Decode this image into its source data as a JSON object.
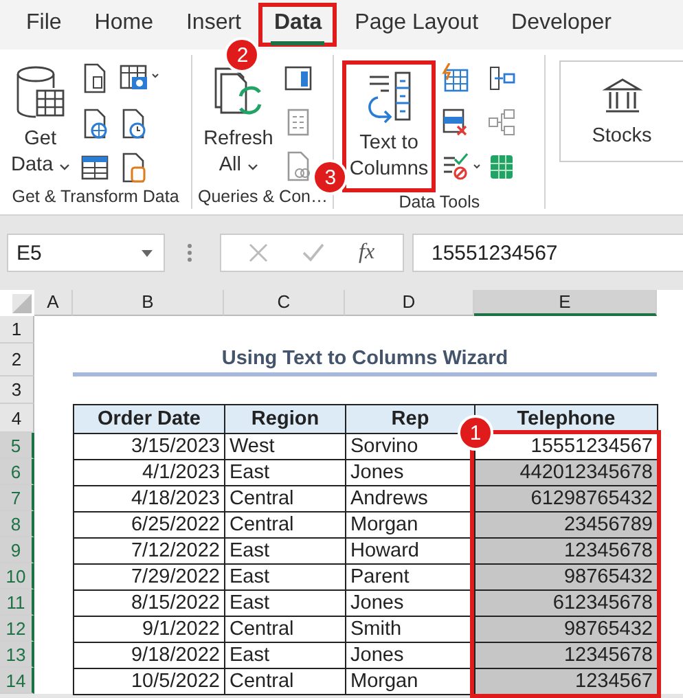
{
  "tabs": [
    {
      "label": "File",
      "selected": false
    },
    {
      "label": "Home",
      "selected": false
    },
    {
      "label": "Insert",
      "selected": false
    },
    {
      "label": "Data",
      "selected": true,
      "callout": "2"
    },
    {
      "label": "Page Layout",
      "selected": false
    },
    {
      "label": "Developer",
      "selected": false
    }
  ],
  "ribbon": {
    "get_data": {
      "lines": [
        "Get",
        "Data"
      ]
    },
    "refresh_all": {
      "lines": [
        "Refresh",
        "All"
      ]
    },
    "text_to_columns": {
      "lines": [
        "Text to",
        "Columns"
      ],
      "highlighted": true,
      "callout": "3"
    },
    "stocks": {
      "label": "Stocks"
    },
    "group_labels": [
      "Get & Transform Data",
      "Queries & Con…",
      "Data Tools"
    ]
  },
  "formula_bar": {
    "name_box": "E5",
    "function_label": "fx",
    "formula": "15551234567"
  },
  "columns": [
    {
      "letter": "A",
      "selected": false
    },
    {
      "letter": "B",
      "selected": false
    },
    {
      "letter": "C",
      "selected": false
    },
    {
      "letter": "D",
      "selected": false
    },
    {
      "letter": "E",
      "selected": true
    }
  ],
  "rows": [
    {
      "number": "1",
      "selected": false
    },
    {
      "number": "2",
      "selected": false
    },
    {
      "number": "3",
      "selected": false
    },
    {
      "number": "4",
      "selected": false
    },
    {
      "number": "5",
      "selected": true
    },
    {
      "number": "6",
      "selected": true
    },
    {
      "number": "7",
      "selected": true
    },
    {
      "number": "8",
      "selected": true
    },
    {
      "number": "9",
      "selected": true
    },
    {
      "number": "10",
      "selected": true
    },
    {
      "number": "11",
      "selected": true
    },
    {
      "number": "12",
      "selected": true
    },
    {
      "number": "13",
      "selected": true
    },
    {
      "number": "14",
      "selected": true
    }
  ],
  "title": "Using Text to Columns Wizard",
  "table": {
    "headers": [
      "Order Date",
      "Region",
      "Rep",
      "Telephone"
    ],
    "rows": [
      [
        "3/15/2023",
        "West",
        "Sorvino",
        "15551234567"
      ],
      [
        "4/1/2023",
        "East",
        "Jones",
        "442012345678"
      ],
      [
        "4/18/2023",
        "Central",
        "Andrews",
        "61298765432"
      ],
      [
        "6/25/2022",
        "Central",
        "Morgan",
        "23456789"
      ],
      [
        "7/12/2022",
        "East",
        "Howard",
        "12345678"
      ],
      [
        "7/29/2022",
        "East",
        "Parent",
        "98765432"
      ],
      [
        "8/15/2022",
        "East",
        "Jones",
        "612345678"
      ],
      [
        "9/1/2022",
        "Central",
        "Smith",
        "98765432"
      ],
      [
        "9/18/2022",
        "East",
        "Jones",
        "12345678"
      ],
      [
        "10/5/2022",
        "Central",
        "Morgan",
        "1234567"
      ]
    ]
  },
  "selection": {
    "highlighted": true,
    "callout": "1"
  }
}
